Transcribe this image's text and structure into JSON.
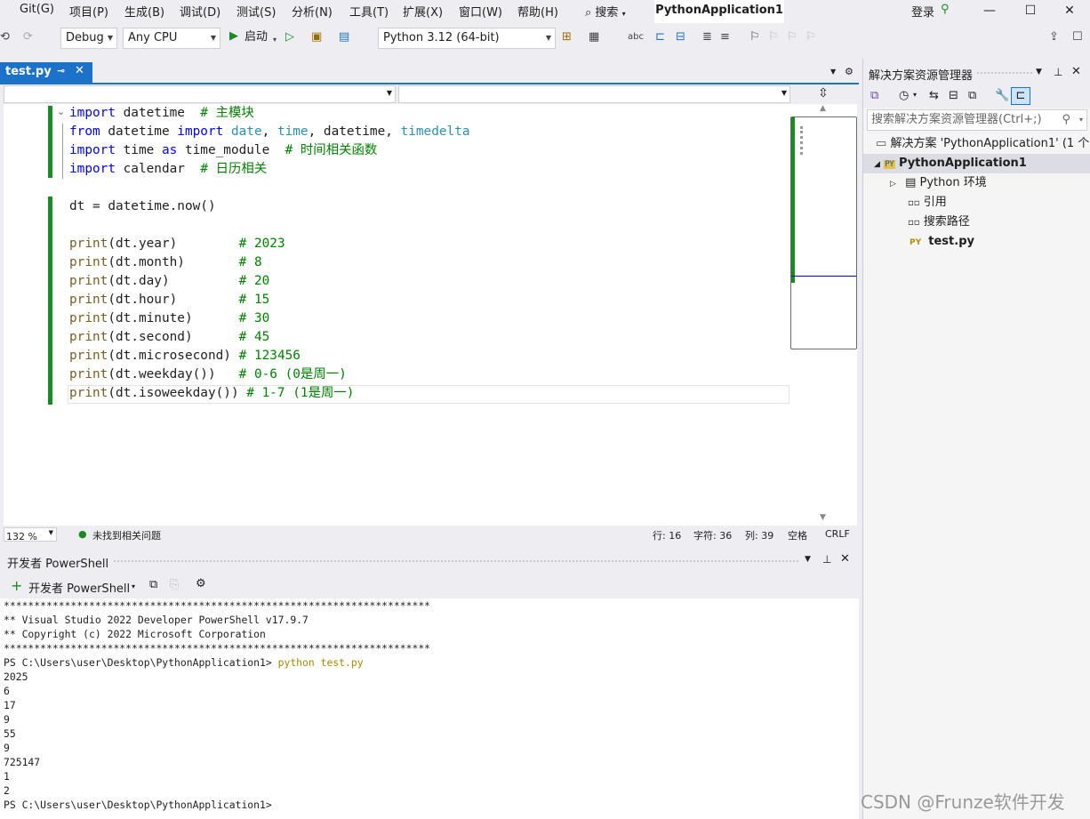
{
  "menu": {
    "items": [
      "Git(G)",
      "项目(P)",
      "生成(B)",
      "调试(D)",
      "测试(S)",
      "分析(N)",
      "工具(T)",
      "扩展(X)",
      "窗口(W)",
      "帮助(H)"
    ],
    "search_label": "搜索",
    "app_title": "PythonApplication1",
    "login_label": "登录"
  },
  "toolbar": {
    "config": "Debug",
    "platform": "Any CPU",
    "start_label": "启动",
    "python_env": "Python 3.12 (64-bit)"
  },
  "editor": {
    "tab_label": "test.py",
    "lines": [
      [
        [
          "kw",
          "import"
        ],
        [
          "plain",
          " datetime  "
        ],
        [
          "cm",
          "# 主模块"
        ]
      ],
      [
        [
          "kw",
          "from"
        ],
        [
          "plain",
          " datetime "
        ],
        [
          "kw",
          "import"
        ],
        [
          "plain",
          " "
        ],
        [
          "cls",
          "date"
        ],
        [
          "plain",
          ", "
        ],
        [
          "cls",
          "time"
        ],
        [
          "plain",
          ", datetime, "
        ],
        [
          "cls",
          "timedelta"
        ]
      ],
      [
        [
          "kw",
          "import"
        ],
        [
          "plain",
          " time "
        ],
        [
          "kw",
          "as"
        ],
        [
          "plain",
          " time_module  "
        ],
        [
          "cm",
          "# 时间相关函数"
        ]
      ],
      [
        [
          "kw",
          "import"
        ],
        [
          "plain",
          " calendar  "
        ],
        [
          "cm",
          "# 日历相关"
        ]
      ],
      [],
      [
        [
          "plain",
          "dt = datetime.now()"
        ]
      ],
      [],
      [
        [
          "fn",
          "print"
        ],
        [
          "plain",
          "(dt.year)        "
        ],
        [
          "cm",
          "# 2023"
        ]
      ],
      [
        [
          "fn",
          "print"
        ],
        [
          "plain",
          "(dt.month)       "
        ],
        [
          "cm",
          "# 8"
        ]
      ],
      [
        [
          "fn",
          "print"
        ],
        [
          "plain",
          "(dt.day)         "
        ],
        [
          "cm",
          "# 20"
        ]
      ],
      [
        [
          "fn",
          "print"
        ],
        [
          "plain",
          "(dt.hour)        "
        ],
        [
          "cm",
          "# 15"
        ]
      ],
      [
        [
          "fn",
          "print"
        ],
        [
          "plain",
          "(dt.minute)      "
        ],
        [
          "cm",
          "# 30"
        ]
      ],
      [
        [
          "fn",
          "print"
        ],
        [
          "plain",
          "(dt.second)      "
        ],
        [
          "cm",
          "# 45"
        ]
      ],
      [
        [
          "fn",
          "print"
        ],
        [
          "plain",
          "(dt.microsecond) "
        ],
        [
          "cm",
          "# 123456"
        ]
      ],
      [
        [
          "fn",
          "print"
        ],
        [
          "plain",
          "(dt.weekday())   "
        ],
        [
          "cm",
          "# 0-6 (0是周一)"
        ]
      ],
      [
        [
          "fn",
          "print"
        ],
        [
          "plain",
          "(dt.isoweekday()) "
        ],
        [
          "cm",
          "# 1-7 (1是周一)"
        ]
      ]
    ]
  },
  "status": {
    "zoom": "132 %",
    "issues": "未找到相关问题",
    "line": "行: 16",
    "char": "字符: 36",
    "col": "列: 39",
    "whitespace": "空格",
    "eol": "CRLF"
  },
  "terminal": {
    "panel_title": "开发者 PowerShell",
    "new_label": "开发者 PowerShell",
    "lines": [
      "**********************************************************************",
      "** Visual Studio 2022 Developer PowerShell v17.9.7",
      "** Copyright (c) 2022 Microsoft Corporation",
      "**********************************************************************",
      "PS C:\\Users\\user\\Desktop\\PythonApplication1> ",
      "2025",
      "6",
      "17",
      "9",
      "55",
      "9",
      "725147",
      "1",
      "2",
      "PS C:\\Users\\user\\Desktop\\PythonApplication1>"
    ],
    "command": "python test.py"
  },
  "solution": {
    "title": "解决方案资源管理器",
    "search_placeholder": "搜索解决方案资源管理器(Ctrl+;)",
    "root": "解决方案 'PythonApplication1' (1 个",
    "project": "PythonApplication1",
    "env": "Python 环境",
    "refs": "引用",
    "search_paths": "搜索路径",
    "file": "test.py"
  },
  "watermark": "CSDN @Frunze软件开发"
}
